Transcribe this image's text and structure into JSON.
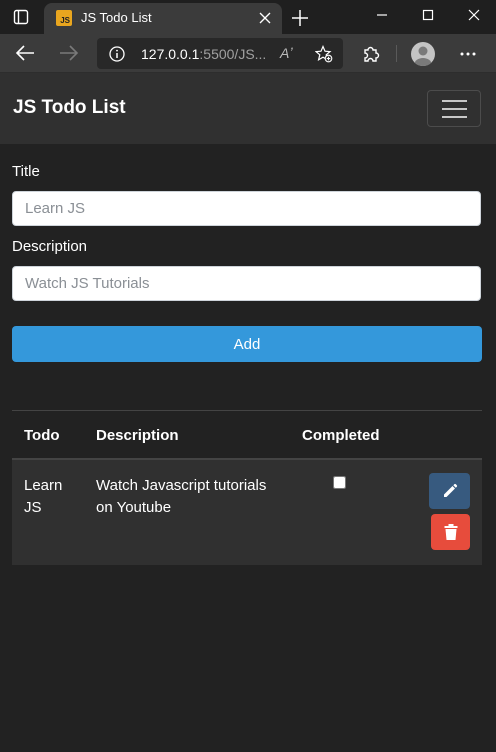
{
  "browser": {
    "tab_title": "JS Todo List",
    "favicon_text": "JS",
    "url_host": "127.0.0.1",
    "url_rest": ":5500/JS...",
    "read_aloud": "Aʼ"
  },
  "navbar": {
    "brand": "JS Todo List"
  },
  "form": {
    "title_label": "Title",
    "title_placeholder": "Learn JS",
    "description_label": "Description",
    "description_placeholder": "Watch JS Tutorials",
    "add_label": "Add"
  },
  "table": {
    "headers": [
      "Todo",
      "Description",
      "Completed"
    ],
    "rows": [
      {
        "todo": "Learn JS",
        "description": "Watch Javascript tutorials on Youtube",
        "completed": false
      }
    ]
  },
  "colors": {
    "primary": "#3498db",
    "edit": "#375a7f",
    "delete": "#e74c3c",
    "navbar": "#303030",
    "background": "#222222"
  }
}
